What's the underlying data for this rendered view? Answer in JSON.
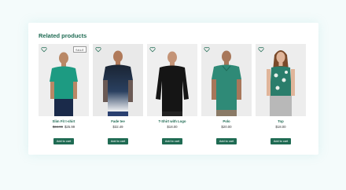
{
  "section": {
    "title": "Related products"
  },
  "products": [
    {
      "name": "Slim Fit t-shirt",
      "old_price": "$34.99",
      "price": "$25.99",
      "badge": "SALE",
      "button": "Add to cart",
      "shirt_color": "#1d9b82",
      "bg_color": "#eeeeee"
    },
    {
      "name": "Fade tee",
      "old_price": "",
      "price": "$32.49",
      "badge": "",
      "button": "Add to cart",
      "shirt_color": "#1a2433",
      "bg_color": "#e9e9e9"
    },
    {
      "name": "T-Shirt with Logo",
      "old_price": "",
      "price": "$18.00",
      "badge": "",
      "button": "Add to cart",
      "shirt_color": "#151515",
      "bg_color": "#efefef"
    },
    {
      "name": "Polo",
      "old_price": "",
      "price": "$20.00",
      "badge": "",
      "button": "Add to cart",
      "shirt_color": "#2f8a77",
      "bg_color": "#ececec"
    },
    {
      "name": "Top",
      "old_price": "",
      "price": "$18.00",
      "badge": "",
      "button": "Add to cart",
      "shirt_color": "#2a7d6b",
      "bg_color": "#ededed"
    }
  ],
  "colors": {
    "accent": "#1f6b53",
    "page_bg": "#f4fbfb",
    "card_bg": "#ffffff"
  }
}
